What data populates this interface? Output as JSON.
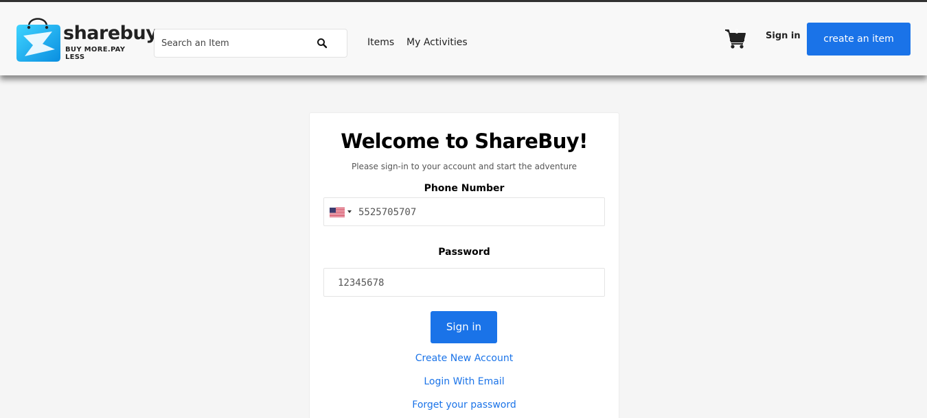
{
  "header": {
    "logo": {
      "brand": "sharebuy",
      "tagline": "BUY MORE.PAY LESS"
    },
    "search": {
      "placeholder": "Search an Item",
      "value": ""
    },
    "nav": {
      "items_label": "Items",
      "activities_label": "My Activities"
    },
    "cart": {
      "count": "0"
    },
    "signin_label": "Sign in",
    "create_label": "create an item"
  },
  "login": {
    "title": "Welcome to ShareBuy!",
    "subtitle": "Please sign-in to your account and start the adventure",
    "phone_label": "Phone Number",
    "phone_value": "5525705707",
    "password_label": "Password",
    "password_value": "12345678",
    "signin_button": "Sign in",
    "links": {
      "create_account": "Create New Account",
      "login_email": "Login With Email",
      "forgot_password": "Forget your password"
    }
  },
  "colors": {
    "accent": "#1a73e8",
    "background": "#f5f5f5",
    "header_bg": "#f8f8f8"
  },
  "icons": {
    "search": "search-icon",
    "cart": "cart-icon",
    "flag": "us-flag-icon"
  }
}
